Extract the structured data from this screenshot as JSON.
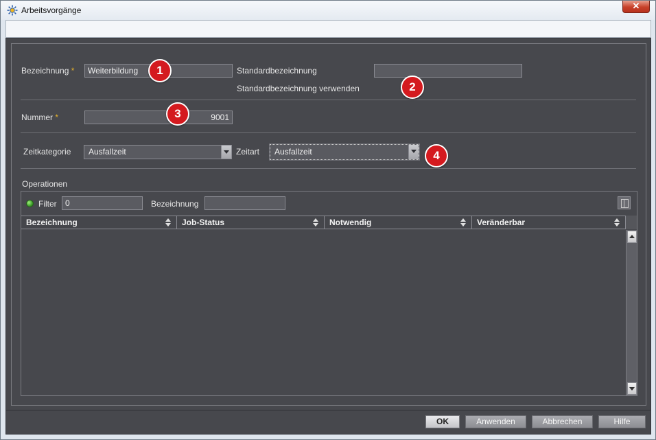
{
  "window": {
    "title": "Arbeitsvorgänge",
    "close_label": "✕"
  },
  "form": {
    "bezeichnung_label": "Bezeichnung",
    "required_mark": "*",
    "bezeichnung_value": "Weiterbildung",
    "standardbezeichnung_label": "Standardbezeichnung",
    "standardbezeichnung_value": "",
    "standardbezeichnung_verwenden_label": "Standardbezeichnung verwenden",
    "nummer_label": "Nummer",
    "nummer_value": "9001",
    "zeitkategorie_label": "Zeitkategorie",
    "zeitkategorie_value": "Ausfallzeit",
    "zeitart_label": "Zeitart",
    "zeitart_value": "Ausfallzeit"
  },
  "callouts": [
    "1",
    "2",
    "3",
    "4"
  ],
  "operationen": {
    "section_label": "Operationen",
    "filter_label": "Filter",
    "filter_value": "0",
    "bezeichnung_filter_label": "Bezeichnung",
    "bezeichnung_filter_value": "",
    "columns": [
      "Bezeichnung",
      "Job-Status",
      "Notwendig",
      "Veränderbar"
    ],
    "rows": []
  },
  "buttons": {
    "ok": "OK",
    "apply": "Anwenden",
    "cancel": "Abbrechen",
    "help": "Hilfe"
  },
  "colors": {
    "accent_red": "#d41a1f",
    "required_star": "#e8b32a",
    "filter_status": "#3cb82a",
    "panel_bg": "#47484d"
  }
}
